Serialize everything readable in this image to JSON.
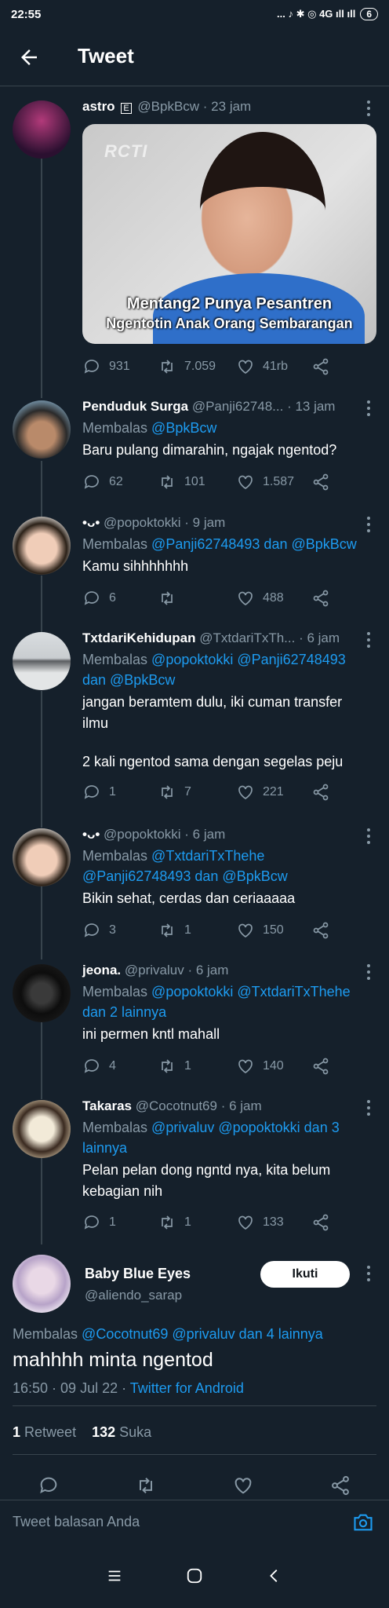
{
  "status_bar": {
    "time": "22:55",
    "icons": "... ♪ ✱ ◎ 4G ıll ıll",
    "battery": "6"
  },
  "header": {
    "title": "Tweet"
  },
  "tweets": [
    {
      "name": "astro",
      "badge": "E",
      "handle": "@BpkBcw",
      "time": "· 23 jam",
      "media": {
        "logo": "RCTI",
        "caption_line1": "Mentang2 Punya Pesantren",
        "caption_line2": "Ngentotin Anak Orang Sembarangan"
      },
      "replies": "931",
      "retweets": "7.059",
      "likes": "41rb"
    },
    {
      "name": "Penduduk Surga",
      "handle": "@Panji62748...",
      "time": "· 13 jam",
      "reply_prefix": "Membalas",
      "reply_to": "@BpkBcw",
      "text": "Baru pulang dimarahin, ngajak ngentod?",
      "replies": "62",
      "retweets": "101",
      "likes": "1.587"
    },
    {
      "name": "•ᴗ•",
      "handle": "@popoktokki",
      "time": "· 9 jam",
      "reply_prefix": "Membalas",
      "reply_to": "@Panji62748493 dan @BpkBcw",
      "text": "Kamu sihhhhhhh",
      "replies": "6",
      "retweets": "",
      "likes": "488"
    },
    {
      "name": "TxtdariKehidupan",
      "handle": "@TxtdariTxTh...",
      "time": "· 6 jam",
      "reply_prefix": "Membalas",
      "reply_to": "@popoktokki @Panji62748493 dan @BpkBcw",
      "text": "jangan beramtem dulu, iki cuman transfer ilmu",
      "text2": "2 kali ngentod sama dengan segelas peju",
      "replies": "1",
      "retweets": "7",
      "likes": "221"
    },
    {
      "name": "•ᴗ•",
      "handle": "@popoktokki",
      "time": "· 6 jam",
      "reply_prefix": "Membalas",
      "reply_to": "@TxtdariTxThehe @Panji62748493 dan @BpkBcw",
      "text": "Bikin sehat, cerdas dan ceriaaaaa",
      "replies": "3",
      "retweets": "1",
      "likes": "150"
    },
    {
      "name": "jeona.",
      "handle": "@privaluv",
      "time": "· 6 jam",
      "reply_prefix": "Membalas",
      "reply_to": "@popoktokki @TxtdariTxThehe dan 2 lainnya",
      "text": "ini permen kntl mahall",
      "replies": "4",
      "retweets": "1",
      "likes": "140"
    },
    {
      "name": "Takaras",
      "handle": "@Cocotnut69",
      "time": "· 6 jam",
      "reply_prefix": "Membalas",
      "reply_to": "@privaluv @popoktokki dan 3 lainnya",
      "text": "Pelan pelan dong ngntd nya, kita belum kebagian nih",
      "replies": "1",
      "retweets": "1",
      "likes": "133"
    }
  ],
  "main_tweet": {
    "name": "Baby Blue Eyes",
    "handle": "@aliendo_sarap",
    "follow_label": "Ikuti",
    "reply_prefix": "Membalas",
    "reply_to": "@Cocotnut69 @privaluv dan 4 lainnya",
    "text": "mahhhh minta ngentod",
    "timestamp": "16:50 · 09 Jul 22 ·",
    "source": "Twitter for Android",
    "retweet_count": "1",
    "retweet_label": "Retweet",
    "like_count": "132",
    "like_label": "Suka"
  },
  "compose": {
    "placeholder": "Tweet balasan Anda"
  },
  "colors": {
    "background": "#15202b",
    "accent": "#1d9bf0",
    "muted": "#8899a6",
    "divider": "#38444d"
  }
}
